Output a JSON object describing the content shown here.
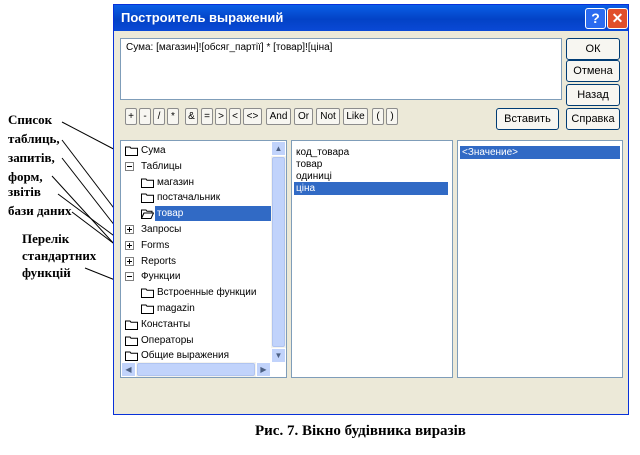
{
  "window": {
    "title": "Построитель выражений",
    "help_icon": "?",
    "close_icon": "✕"
  },
  "expression": "Сума:  [магазин]![обсяг_партії] * [товар]![ціна]",
  "buttons": {
    "ok": "ОК",
    "cancel": "Отмена",
    "back": "Назад",
    "insert": "Вставить",
    "help": "Справка"
  },
  "operators": [
    "+",
    "-",
    "/",
    "*",
    "&",
    "=",
    ">",
    "<",
    "<>",
    "And",
    "Or",
    "Not",
    "Like",
    "(",
    ")"
  ],
  "tree": [
    {
      "label": "Сума",
      "icon": "folder",
      "level": 0
    },
    {
      "label": "Таблицы",
      "icon": "minus-box",
      "level": 0
    },
    {
      "label": "магазин",
      "icon": "folder",
      "level": 1
    },
    {
      "label": "постачальник",
      "icon": "folder",
      "level": 1
    },
    {
      "label": "товар",
      "icon": "folder-open",
      "level": 1,
      "selected": true
    },
    {
      "label": "Запросы",
      "icon": "plus-box",
      "level": 0
    },
    {
      "label": "Forms",
      "icon": "plus-box",
      "level": 0
    },
    {
      "label": "Reports",
      "icon": "plus-box",
      "level": 0
    },
    {
      "label": "Функции",
      "icon": "minus-box",
      "level": 0
    },
    {
      "label": "Встроенные функции",
      "icon": "folder",
      "level": 1
    },
    {
      "label": "magazin",
      "icon": "folder",
      "level": 1
    },
    {
      "label": "Константы",
      "icon": "folder",
      "level": 0
    },
    {
      "label": "Операторы",
      "icon": "folder",
      "level": 0
    },
    {
      "label": "Общие выражения",
      "icon": "folder",
      "level": 0
    }
  ],
  "fields": [
    {
      "label": "код_товара"
    },
    {
      "label": "товар"
    },
    {
      "label": "одиниці"
    },
    {
      "label": "ціна",
      "selected": true
    }
  ],
  "values": [
    {
      "label": "<Значение>",
      "selected": true
    }
  ],
  "annotations": {
    "objects": [
      "Список",
      "таблиць,",
      "запитів,",
      "форм,",
      "звітів",
      "бази даних"
    ],
    "functions": [
      "Перелік",
      "стандартних",
      "функцій"
    ]
  },
  "caption": "Рис. 7. Вікно будівника виразів",
  "colors": {
    "title_bar": "#0a5fe6",
    "selection": "#316ac5",
    "dialog_bg": "#ece9d8"
  }
}
